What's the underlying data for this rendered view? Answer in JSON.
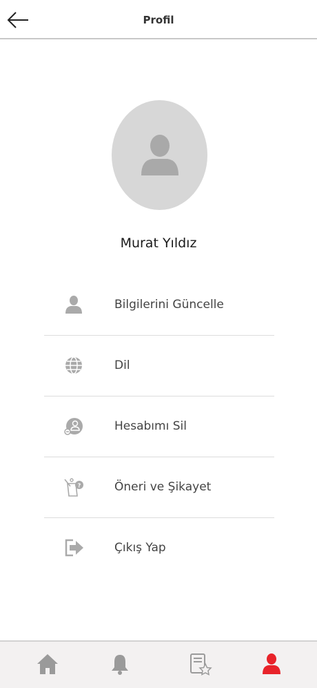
{
  "header": {
    "title": "Profil"
  },
  "profile": {
    "name": "Murat Yıldız"
  },
  "menu": {
    "items": [
      {
        "label": "Bilgilerini Güncelle",
        "icon": "user-edit-icon"
      },
      {
        "label": "Dil",
        "icon": "globe-icon"
      },
      {
        "label": "Hesabımı Sil",
        "icon": "delete-account-icon"
      },
      {
        "label": "Öneri ve Şikayet",
        "icon": "feedback-icon"
      },
      {
        "label": "Çıkış Yap",
        "icon": "logout-icon"
      }
    ]
  },
  "tabbar": {
    "tabs": [
      {
        "icon": "home-icon",
        "active": false
      },
      {
        "icon": "bell-icon",
        "active": false
      },
      {
        "icon": "favorites-icon",
        "active": false
      },
      {
        "icon": "profile-icon",
        "active": true
      }
    ]
  },
  "colors": {
    "active": "#e8232a",
    "inactive": "#9a9a9a",
    "icon": "#aaaaaa"
  }
}
